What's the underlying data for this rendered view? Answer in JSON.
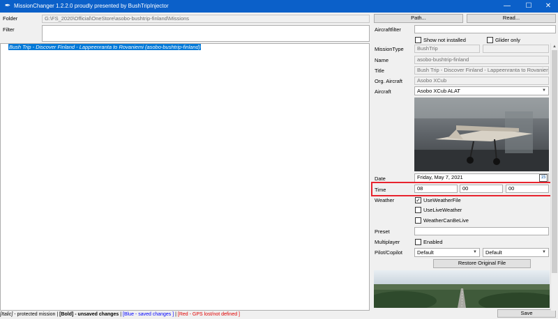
{
  "titlebar": {
    "title": "MissionChanger 1.2.2.0 proudly presented by BushTripInjector",
    "app_icon": "✒",
    "minimize": "—",
    "maximize": "☐",
    "close": "✕"
  },
  "left": {
    "folder_label": "Folder",
    "folder_value": "G:\\FS_2020\\Official\\OneStore\\asobo-bushtrip-finland\\Missions",
    "filter_label": "Filter",
    "filter_value": "",
    "missions": [
      {
        "text": "Bush Trip - Discover Finland - Lappeenranta to Rovaniemi (asobo-bushtrip-finland)",
        "selected": true,
        "italic": true
      }
    ]
  },
  "right": {
    "path_button": "Path...",
    "read_button": "Read...",
    "aircraftfilter_label": "Aircraftfilter",
    "aircraftfilter_value": "",
    "show_not_installed_label": "Show not installed",
    "show_not_installed_checked": false,
    "glider_only_label": "Glider only",
    "glider_only_checked": false,
    "missiontype_label": "MissionType",
    "missiontype_value": "BushTrip",
    "missiontype_value2": "",
    "name_label": "Name",
    "name_value": "asobo-bushtrip-finland",
    "title_label": "Title",
    "title_value": "Bush Trip - Discover Finland - Lappeenranta to Rovaniemi (aso",
    "org_aircraft_label": "Org. Aircraft",
    "org_aircraft_value": "Asobo XCub",
    "aircraft_label": "Aircraft",
    "aircraft_value": "Asobo XCub ALAT",
    "date_label": "Date",
    "date_value": "Friday, May 7, 2021",
    "calendar_icon_text": "15",
    "time_label": "Time",
    "time_hour": "08",
    "time_minute": "00",
    "time_second": "00",
    "weather_label": "Weather",
    "use_weather_file_label": "UseWeatherFile",
    "use_weather_file_checked": true,
    "use_live_weather_label": "UseLiveWeather",
    "use_live_weather_checked": false,
    "weather_can_be_live_label": "WeatherCanBeLive",
    "weather_can_be_live_checked": false,
    "preset_label": "Preset",
    "preset_value": "",
    "multiplayer_label": "Multiplayer",
    "multiplayer_enabled_label": "Enabled",
    "multiplayer_enabled_checked": false,
    "pilot_copilot_label": "Pilot/Copilot",
    "pilot_value": "Default",
    "copilot_value": "Default",
    "restore_button": "Restore Original File",
    "save_button": "Save"
  },
  "status": {
    "italic_part": "[Italic]",
    "italic_desc": " - protected mission",
    "sep1": " | ",
    "bold_part": "[Bold]",
    "bold_desc": " - unsaved changes",
    "sep2": " | ",
    "blue_part": "[Blue - saved changes ]",
    "sep3": " | ",
    "red_part": "[Red - GPS lost/not defined ]"
  },
  "colors": {
    "titlebar": "#0b60c9",
    "selection": "#0078d7",
    "highlight_box": "#e8232d"
  }
}
